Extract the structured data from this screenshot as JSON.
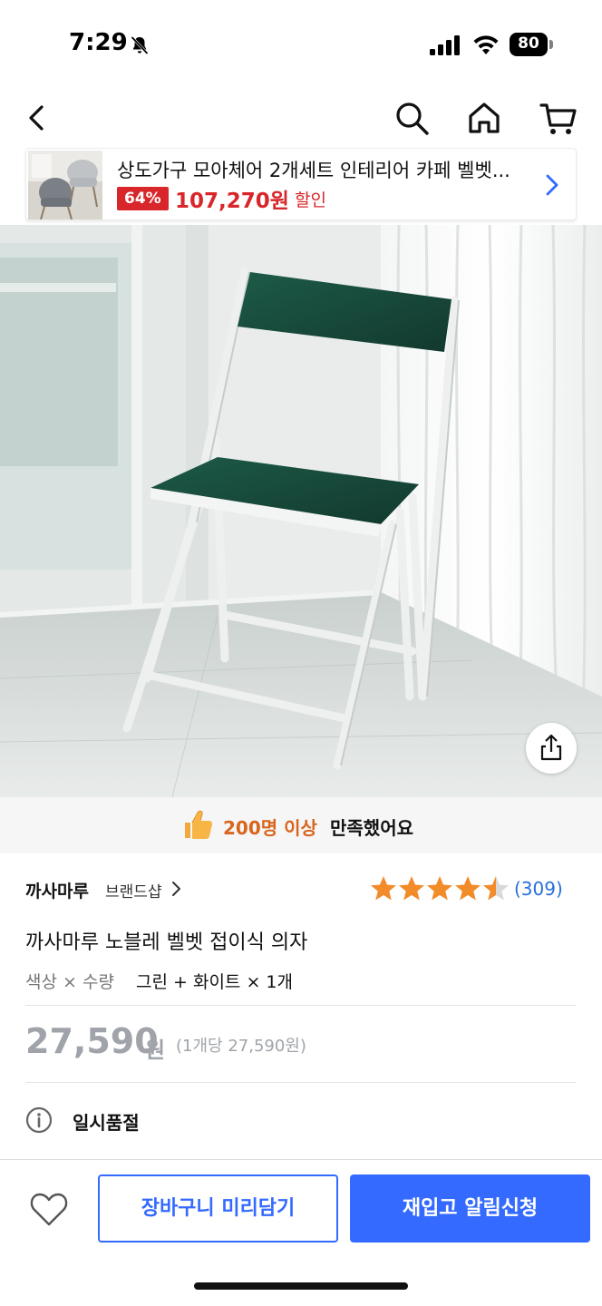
{
  "status_bar": {
    "time": "7:29",
    "battery": "80"
  },
  "promo": {
    "title": "상도가구 모아체어 2개세트 인테리어 카페 벨벳...",
    "discount": "64%",
    "price": "107,270원",
    "sale_label": "할인"
  },
  "satisfaction": {
    "highlight": "200명 이상",
    "text": "만족했어요"
  },
  "product": {
    "brand": "까사마루",
    "brand_shop": "브랜드샵",
    "rating": 4.5,
    "review_count": "(309)",
    "title": "까사마루 노블레 벨벳 접이식 의자",
    "option_label": "색상 × 수량",
    "option_value": "그린 + 화이트 × 1개",
    "price": "27,590",
    "price_unit": "원",
    "unit_price_note": "(1개당 27,590원)",
    "status": "일시품절"
  },
  "actions": {
    "cart_label": "장바구니 미리담기",
    "restock_label": "재입고 알림신청"
  },
  "colors": {
    "accent_blue": "#346aff",
    "discount_red": "#d8262b",
    "star_orange": "#f28b2a",
    "satisfaction_orange": "#d9651c",
    "chair_green": "#1a4d3d"
  },
  "icons": [
    "bell-off-icon",
    "signal-icon",
    "wifi-icon",
    "back-icon",
    "search-icon",
    "home-icon",
    "cart-icon",
    "chevron-right-icon",
    "share-icon",
    "thumbs-up-icon",
    "star-icon",
    "info-icon",
    "heart-icon"
  ]
}
